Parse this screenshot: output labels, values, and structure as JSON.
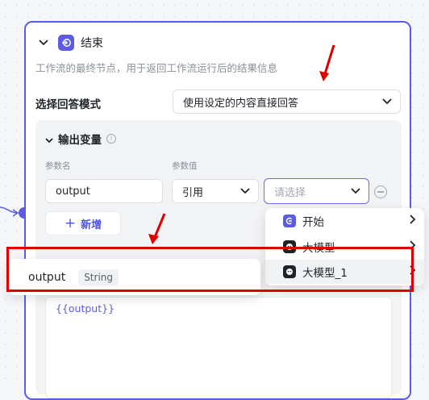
{
  "node": {
    "title": "结束",
    "description": "工作流的最终节点，用于返回工作流运行后的结果信息",
    "icon": "exit-icon"
  },
  "answer_mode": {
    "label": "选择回答模式",
    "selected": "使用设定的内容直接回答"
  },
  "output_vars": {
    "label": "输出变量",
    "col_name": "参数名",
    "col_value": "参数值",
    "name_value": "output",
    "ref_type": "引用",
    "value_placeholder": "请选择",
    "add_label": "新增"
  },
  "answer_content": {
    "template": "{{output}}"
  },
  "dropdown": {
    "items": [
      {
        "label": "开始",
        "icon": "start-icon"
      },
      {
        "label": "大模型",
        "icon": "llm-icon"
      },
      {
        "label": "大模型_1",
        "icon": "llm-icon"
      }
    ]
  },
  "suggestion": {
    "name": "output",
    "type": "String"
  },
  "colors": {
    "accent": "#5b5ce2",
    "annotation": "#e00000"
  }
}
